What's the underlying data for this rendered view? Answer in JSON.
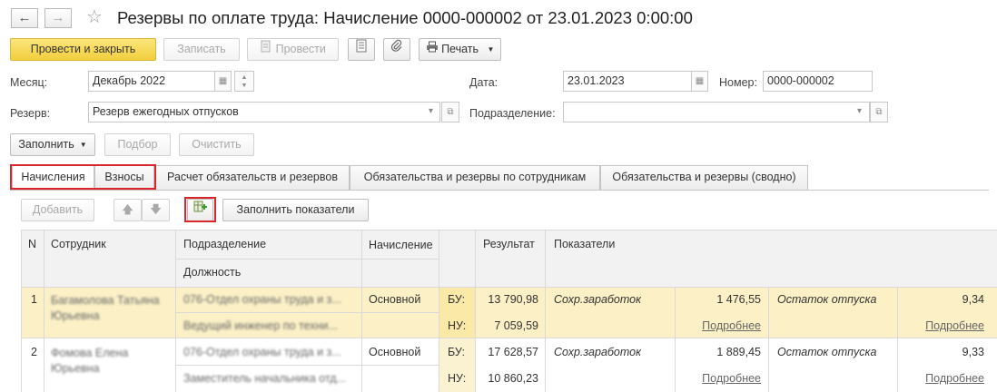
{
  "window": {
    "title": "Резервы по оплате труда: Начисление 0000-000002 от 23.01.2023 0:00:00"
  },
  "toolbar": {
    "post_close": "Провести и закрыть",
    "save": "Записать",
    "post": "Провести",
    "print": "Печать"
  },
  "form": {
    "month_label": "Месяц:",
    "month_value": "Декабрь 2022",
    "date_label": "Дата:",
    "date_value": "23.01.2023",
    "number_label": "Номер:",
    "number_value": "0000-000002",
    "reserve_label": "Резерв:",
    "reserve_value": "Резерв ежегодных отпусков",
    "dept_label": "Подразделение:",
    "dept_value": ""
  },
  "actions": {
    "fill": "Заполнить",
    "select": "Подбор",
    "clear": "Очистить"
  },
  "tabs": [
    {
      "label": "Начисления"
    },
    {
      "label": "Взносы"
    },
    {
      "label": "Расчет обязательств и резервов"
    },
    {
      "label": "Обязательства и резервы по сотрудникам"
    },
    {
      "label": "Обязательства и резервы (сводно)"
    }
  ],
  "table_toolbar": {
    "add": "Добавить",
    "fill_indicators": "Заполнить показатели"
  },
  "table": {
    "headers": {
      "n": "N",
      "employee": "Сотрудник",
      "department": "Подразделение",
      "position": "Должность",
      "accrual": "Начисление",
      "result": "Результат",
      "indicators": "Показатели"
    },
    "rows": [
      {
        "n": "1",
        "employee": "Багамолова Татьяна Юрьевна",
        "department": "076-Отдел охраны труда и з...",
        "position": "Ведущий инженер по техни...",
        "accrual": "Основной",
        "bu_label": "БУ:",
        "bu_value": "13 790,98",
        "nu_label": "НУ:",
        "nu_value": "7 059,59",
        "ind1_name": "Сохр.заработок",
        "ind1_value": "1 476,55",
        "ind1_link": "Подробнее",
        "ind2_name": "Остаток отпуска",
        "ind2_value": "9,34",
        "ind2_link": "Подробнее"
      },
      {
        "n": "2",
        "employee": "Фомова Елена Юрьевна",
        "department": "076-Отдел охраны труда и з...",
        "position": "Заместитель начальника отд...",
        "accrual": "Основной",
        "bu_label": "БУ:",
        "bu_value": "17 628,57",
        "nu_label": "НУ:",
        "nu_value": "10 860,23",
        "ind1_name": "Сохр.заработок",
        "ind1_value": "1 889,45",
        "ind1_link": "Подробнее",
        "ind2_name": "Остаток отпуска",
        "ind2_value": "9,33",
        "ind2_link": "Подробнее"
      }
    ]
  },
  "colors": {
    "primary": "#f2cf3d",
    "selected_row": "#fbf0c6",
    "highlight": "#d9262c"
  }
}
